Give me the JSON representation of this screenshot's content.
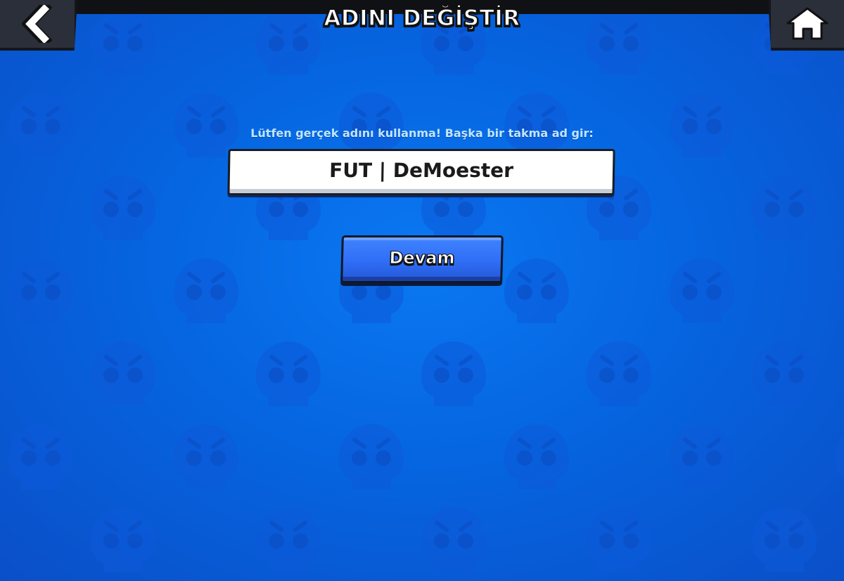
{
  "header": {
    "title": "ADINI DEĞİŞTİR",
    "back_icon": "chevron-left-icon",
    "home_icon": "home-icon"
  },
  "form": {
    "instruction": "Lütfen gerçek adını kullanma! Başka bir takma ad gir:",
    "name_value": "FUT | DeMoester",
    "continue_label": "Devam"
  },
  "theme": {
    "background": "#0a6ae8",
    "pattern_icon": "skull-icon",
    "button_blue": "#2f6ef6",
    "top_bar": "#2a2f3a"
  }
}
